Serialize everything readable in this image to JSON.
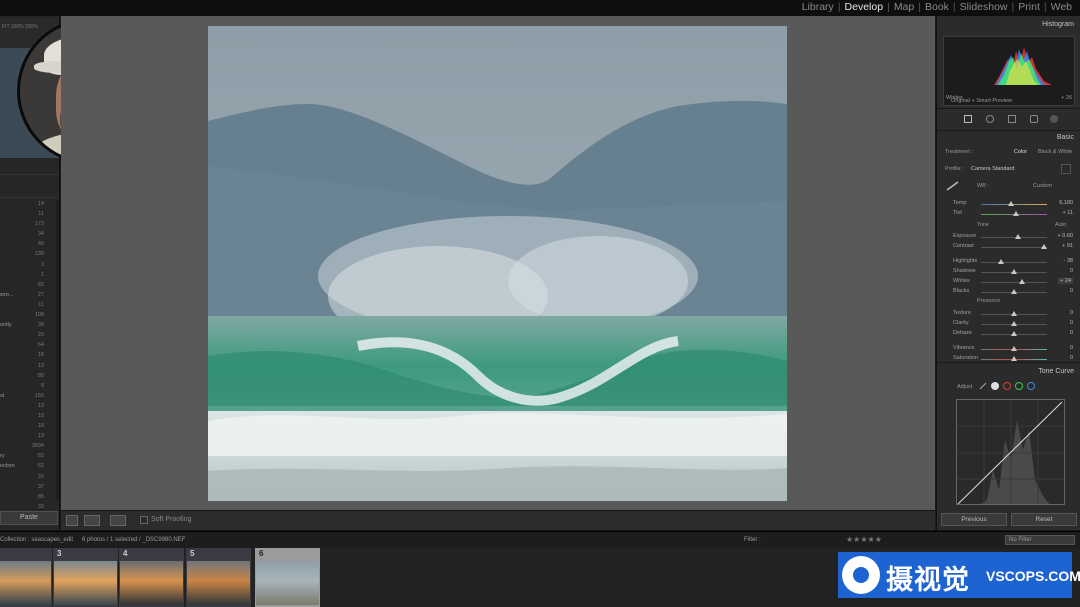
{
  "modules": [
    "Library",
    "Develop",
    "Map",
    "Book",
    "Slideshow",
    "Print",
    "Web"
  ],
  "active_module": "Develop",
  "left_panel": {
    "nav_header": "FIT  100%  200%",
    "rows": [
      {
        "name": "",
        "count": "14"
      },
      {
        "name": "",
        "count": "11"
      },
      {
        "name": "",
        "count": "173"
      },
      {
        "name": "",
        "count": "34"
      },
      {
        "name": "",
        "count": "40"
      },
      {
        "name": "",
        "count": "139"
      },
      {
        "name": "",
        "count": "3"
      },
      {
        "name": "",
        "count": "1"
      },
      {
        "name": "",
        "count": "83"
      },
      {
        "name": "wro...",
        "count": "27"
      },
      {
        "name": "",
        "count": "11"
      },
      {
        "name": "",
        "count": "108"
      },
      {
        "name": "ontly",
        "count": "39"
      },
      {
        "name": "",
        "count": "29"
      },
      {
        "name": "",
        "count": "64"
      },
      {
        "name": "",
        "count": "18"
      },
      {
        "name": "",
        "count": "13"
      },
      {
        "name": "",
        "count": "80"
      },
      {
        "name": "",
        "count": "8"
      },
      {
        "name": "st",
        "count": "159"
      },
      {
        "name": "",
        "count": "13"
      },
      {
        "name": "",
        "count": "18"
      },
      {
        "name": "",
        "count": "18"
      },
      {
        "name": "",
        "count": "19"
      },
      {
        "name": "",
        "count": "3694"
      },
      {
        "name": "ry",
        "count": "82"
      },
      {
        "name": "ection",
        "count": "62"
      },
      {
        "name": "",
        "count": "26"
      },
      {
        "name": "",
        "count": "37"
      },
      {
        "name": "",
        "count": "85"
      },
      {
        "name": "",
        "count": "33"
      }
    ],
    "paste_label": "Paste"
  },
  "toolbar": {
    "soft_proofing": "Soft Proofing"
  },
  "right_panel": {
    "histogram_title": "Histogram",
    "histogram_label": "Whites",
    "histogram_value": "+ 26",
    "preview_label": "Original + Smart Preview",
    "basic_title": "Basic",
    "treatment_label": "Treatment :",
    "treatment_color": "Color",
    "treatment_bw": "Black & White",
    "profile_label": "Profile :",
    "profile_value": "Camera Standard",
    "wb_label": "WB :",
    "wb_value": "Custom",
    "tone_label": "Tone",
    "auto_label": "Auto",
    "presence_label": "Presence",
    "sliders": [
      {
        "label": "Temp",
        "value": "6,180",
        "pos": 0.45
      },
      {
        "label": "Tint",
        "value": "+ 11",
        "pos": 0.53
      },
      {
        "label": "Exposure",
        "value": "+ 0.60",
        "pos": 0.56
      },
      {
        "label": "Contrast",
        "value": "+ 91",
        "pos": 0.95
      },
      {
        "label": "Highlights",
        "value": "- 38",
        "pos": 0.31
      },
      {
        "label": "Shadows",
        "value": "0",
        "pos": 0.5
      },
      {
        "label": "Whites",
        "value": "+ 24",
        "pos": 0.62
      },
      {
        "label": "Blacks",
        "value": "0",
        "pos": 0.5
      },
      {
        "label": "Texture",
        "value": "0",
        "pos": 0.5
      },
      {
        "label": "Clarity",
        "value": "0",
        "pos": 0.5
      },
      {
        "label": "Dehaze",
        "value": "0",
        "pos": 0.5
      },
      {
        "label": "Vibrance",
        "value": "0",
        "pos": 0.5
      },
      {
        "label": "Saturation",
        "value": "0",
        "pos": 0.5
      }
    ],
    "tone_curve_title": "Tone Curve",
    "adjust_label": "Adjust",
    "previous_label": "Previous",
    "reset_label": "Reset"
  },
  "filmstrip": {
    "source": "Collection : seascapes_edit",
    "info": "6 photos / 1 selected / _DSC9980.NEF",
    "filter_label": "Filter :",
    "no_filter": "No Filter",
    "cells": [
      {
        "num": "",
        "colors": [
          "#6d7b86",
          "#d49b5c",
          "#33414b"
        ]
      },
      {
        "num": "3",
        "colors": [
          "#7b8790",
          "#e1a35f",
          "#3b4750"
        ]
      },
      {
        "num": "4",
        "colors": [
          "#6b6e73",
          "#d6924f",
          "#2f3338"
        ]
      },
      {
        "num": "5",
        "colors": [
          "#70767c",
          "#c98444",
          "#31363b"
        ]
      },
      {
        "num": "6",
        "colors": [
          "#8f9ea6",
          "#a8b5ba",
          "#7c7a6e"
        ]
      }
    ]
  },
  "watermark": {
    "cn": "摄视觉",
    "en": "VSCOPS.COM"
  },
  "colors": {
    "accent": "#1d63d1",
    "panel": "#2b2b2b",
    "canvas": "#595959"
  }
}
